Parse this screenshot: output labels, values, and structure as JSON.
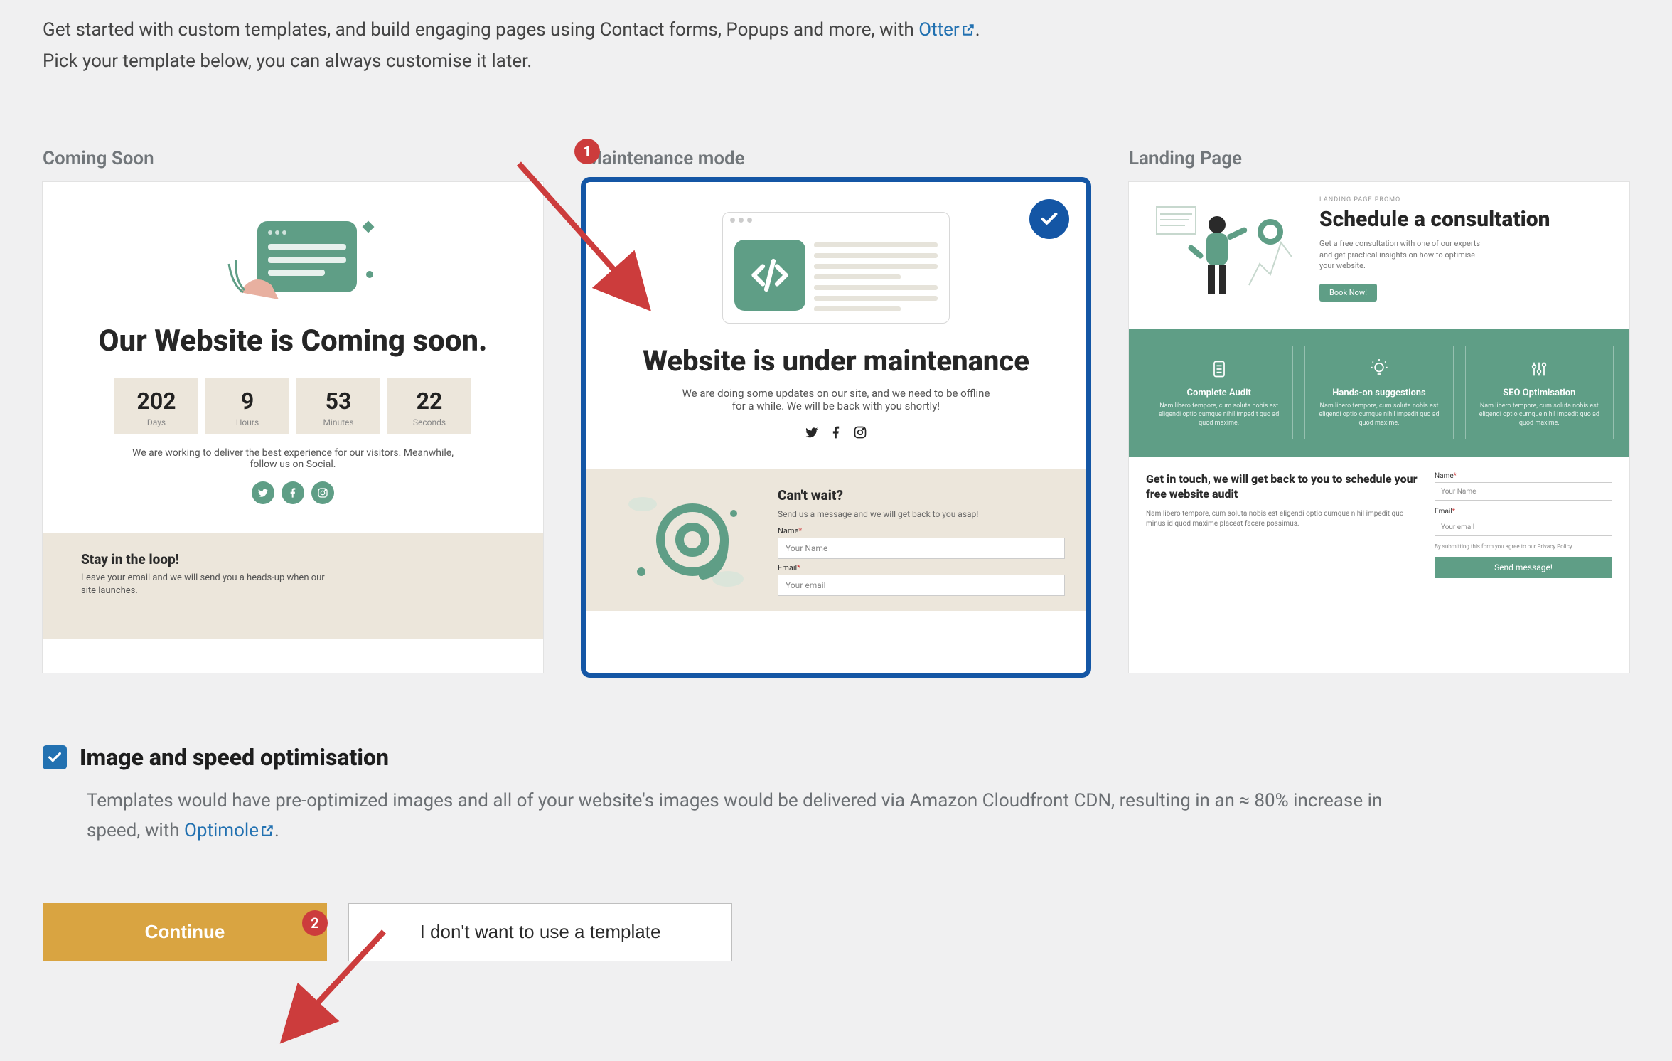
{
  "intro": {
    "line1_a": "Get started with custom templates, and build engaging pages using Contact forms, Popups and more, with ",
    "otter": "Otter",
    "line1_b": ".",
    "line2": "Pick your template below, you can always customise it later."
  },
  "annotations": {
    "step1": "1",
    "step2": "2"
  },
  "columns": {
    "coming_soon": {
      "title": "Coming Soon",
      "headline": "Our Website is Coming soon.",
      "countdown": [
        {
          "num": "202",
          "label": "Days"
        },
        {
          "num": "9",
          "label": "Hours"
        },
        {
          "num": "53",
          "label": "Minutes"
        },
        {
          "num": "22",
          "label": "Seconds"
        }
      ],
      "blurb": "We are working to deliver the best experience for our visitors. Meanwhile, follow us on Social.",
      "loop_title": "Stay in the loop!",
      "loop_sub": "Leave your email and we will send you a heads-up when our site launches."
    },
    "maintenance": {
      "title": "Maintenance mode",
      "selected": true,
      "headline": "Website is under maintenance",
      "sub": "We are doing some updates on our site, and we need to be offline for a while. We will be back with you shortly!",
      "form_title": "Can't wait?",
      "form_sub": "Send us a message and we will get back to you asap!",
      "name_label": "Name",
      "name_ph": "Your Name",
      "email_label": "Email",
      "email_ph": "Your email"
    },
    "landing": {
      "title": "Landing Page",
      "tag": "LANDING PAGE PROMO",
      "headline": "Schedule a consultation",
      "sub": "Get a free consultation with one of our experts and get practical insights on how to optimise your website.",
      "cta": "Book Now!",
      "features": [
        {
          "title": "Complete Audit",
          "desc": "Nam libero tempore, cum soluta nobis est eligendi optio cumque nihil impedit quo ad quod maxime."
        },
        {
          "title": "Hands-on suggestions",
          "desc": "Nam libero tempore, cum soluta nobis est eligendi optio cumque nihil impedit quo ad quod maxime."
        },
        {
          "title": "SEO Optimisation",
          "desc": "Nam libero tempore, cum soluta nobis est eligendi optio cumque nihil impedit quo ad quod maxime."
        }
      ],
      "bottom_title": "Get in touch, we will get back to you to schedule your free website audit",
      "bottom_desc": "Nam libero tempore, cum soluta nobis est eligendi optio cumque nihil impedit quo minus id quod maxime placeat facere possimus.",
      "name_label": "Name",
      "name_ph": "Your Name",
      "email_label": "Email",
      "email_ph": "Your email",
      "note": "By submitting this form you agree to our Privacy Policy",
      "send": "Send message!"
    }
  },
  "optimisation": {
    "checked": true,
    "title": "Image and speed optimisation",
    "desc_a": "Templates would have pre-optimized images and all of your website's images would be delivered via Amazon Cloudfront CDN, resulting in an ≈ 80% increase in speed, with ",
    "optimole": "Optimole",
    "desc_b": "."
  },
  "buttons": {
    "continue": "Continue",
    "skip": "I don't want to use a template"
  }
}
